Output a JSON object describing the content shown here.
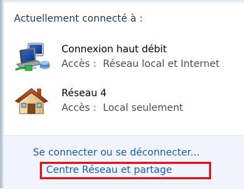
{
  "header": "Actuellement connecté à :",
  "connections": [
    {
      "name": "Connexion haut débit",
      "access_label": "Accès :",
      "access_value": "Réseau local et Internet",
      "icon": "network-connection-icon"
    },
    {
      "name": "Réseau  4",
      "access_label": "Accès :",
      "access_value": "Local seulement",
      "icon": "home-network-icon"
    }
  ],
  "links": {
    "connect_disconnect": "Se connecter ou se déconnecter...",
    "network_center": "Centre Réseau et partage"
  },
  "colors": {
    "link": "#1c5dab",
    "highlight": "#e5131d",
    "header": "#1e395b"
  }
}
